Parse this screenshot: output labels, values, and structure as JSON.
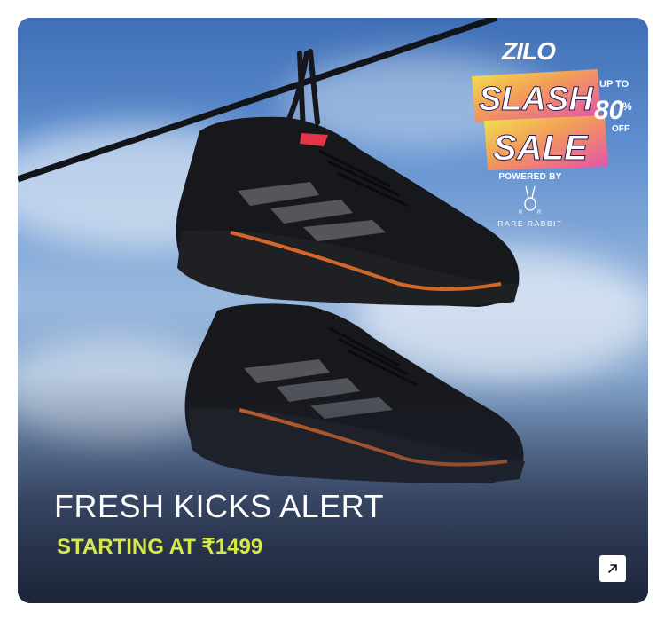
{
  "promo": {
    "headline": "FRESH KICKS ALERT",
    "price_text": "STARTING AT ₹1499",
    "price_color": "#d6e84a",
    "open_icon": "arrow-up-right-icon"
  },
  "badge": {
    "brand": "ZILO",
    "line1": "SLASH",
    "line2": "SALE",
    "discount_prefix": "UP TO",
    "discount_value": "80",
    "discount_percent": "%",
    "discount_suffix": "OFF",
    "powered_by": "POWERED BY",
    "partner": "RARE RABBIT",
    "partner_logo": "rabbit-logo"
  }
}
